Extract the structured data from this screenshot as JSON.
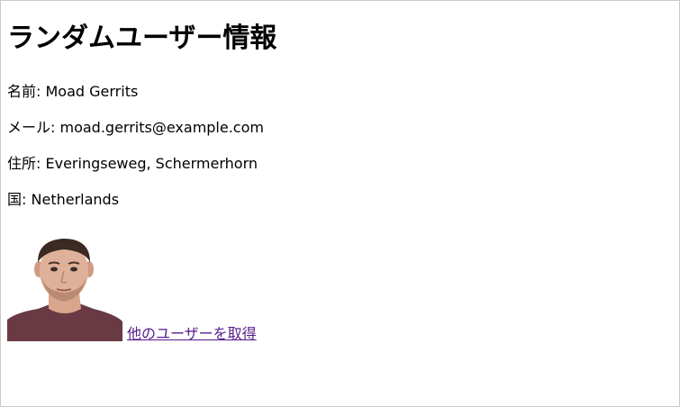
{
  "page": {
    "title": "ランダムユーザー情報"
  },
  "user": {
    "name_label": "名前:",
    "name": "Moad Gerrits",
    "email_label": "メール:",
    "email": "moad.gerrits@example.com",
    "address_label": "住所:",
    "address": "Everingseweg, Schermerhorn",
    "country_label": "国:",
    "country": "Netherlands"
  },
  "actions": {
    "next_user_link": "他のユーザーを取得"
  },
  "colors": {
    "link": "#551a8b",
    "text": "#000000",
    "background": "#ffffff"
  },
  "icons": {
    "photo": "user-portrait"
  }
}
